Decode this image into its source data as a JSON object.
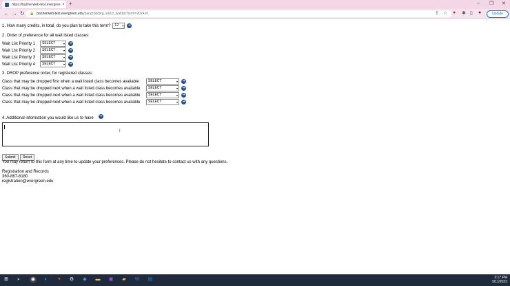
{
  "browser": {
    "tab_title": "https://bannerweb-test.evergree",
    "tab_close": "×",
    "new_tab": "+",
    "win_min": "–",
    "win_max": "❐",
    "win_close": "✕",
    "url_host": "bannerweb-test.evergreen.edu",
    "url_path": "/banprod/pkg_wld.p_waitlist?term=202410",
    "update_label": "Update"
  },
  "form": {
    "q1_label": "1. How many credits, in total, do you plan to take this term?",
    "q1_value": "12",
    "q2_label": "2. Order of preference for all wait listed classes:",
    "waitlist": [
      {
        "label": "Wait List Priority 1",
        "value": "SELECT"
      },
      {
        "label": "Wait List Priority 2",
        "value": "SELECT"
      },
      {
        "label": "Wait List Priority 3",
        "value": "SELECT"
      },
      {
        "label": "Wait List Priority 4",
        "value": "SELECT"
      }
    ],
    "q3_label": "3. DROP preference order, for registered classes:",
    "drop": [
      {
        "label": "Class that may be dropped first when a wait listed class becomes available",
        "value": "SELECT"
      },
      {
        "label": "Class that may be dropped next when a wait listed class becomes available",
        "value": "SELECT"
      },
      {
        "label": "Class that may be dropped next when a wait listed class becomes available",
        "value": "SELECT"
      },
      {
        "label": "Class that may be dropped next when a wait listed class becomes available",
        "value": "SELECT"
      }
    ],
    "q4_label": "4. Additional information you would like us to have",
    "submit_label": "Submit",
    "reset_label": "Reset",
    "note": "You may return to this form at any time to update your preferences. Please do not hesitate to contact us with any questions.",
    "contact_name": "Registration and Records",
    "contact_phone": "360-867-6180",
    "contact_email": "registration@evergreen.edu"
  },
  "taskbar": {
    "time": "3:17 PM",
    "date": "5/11/2023"
  }
}
